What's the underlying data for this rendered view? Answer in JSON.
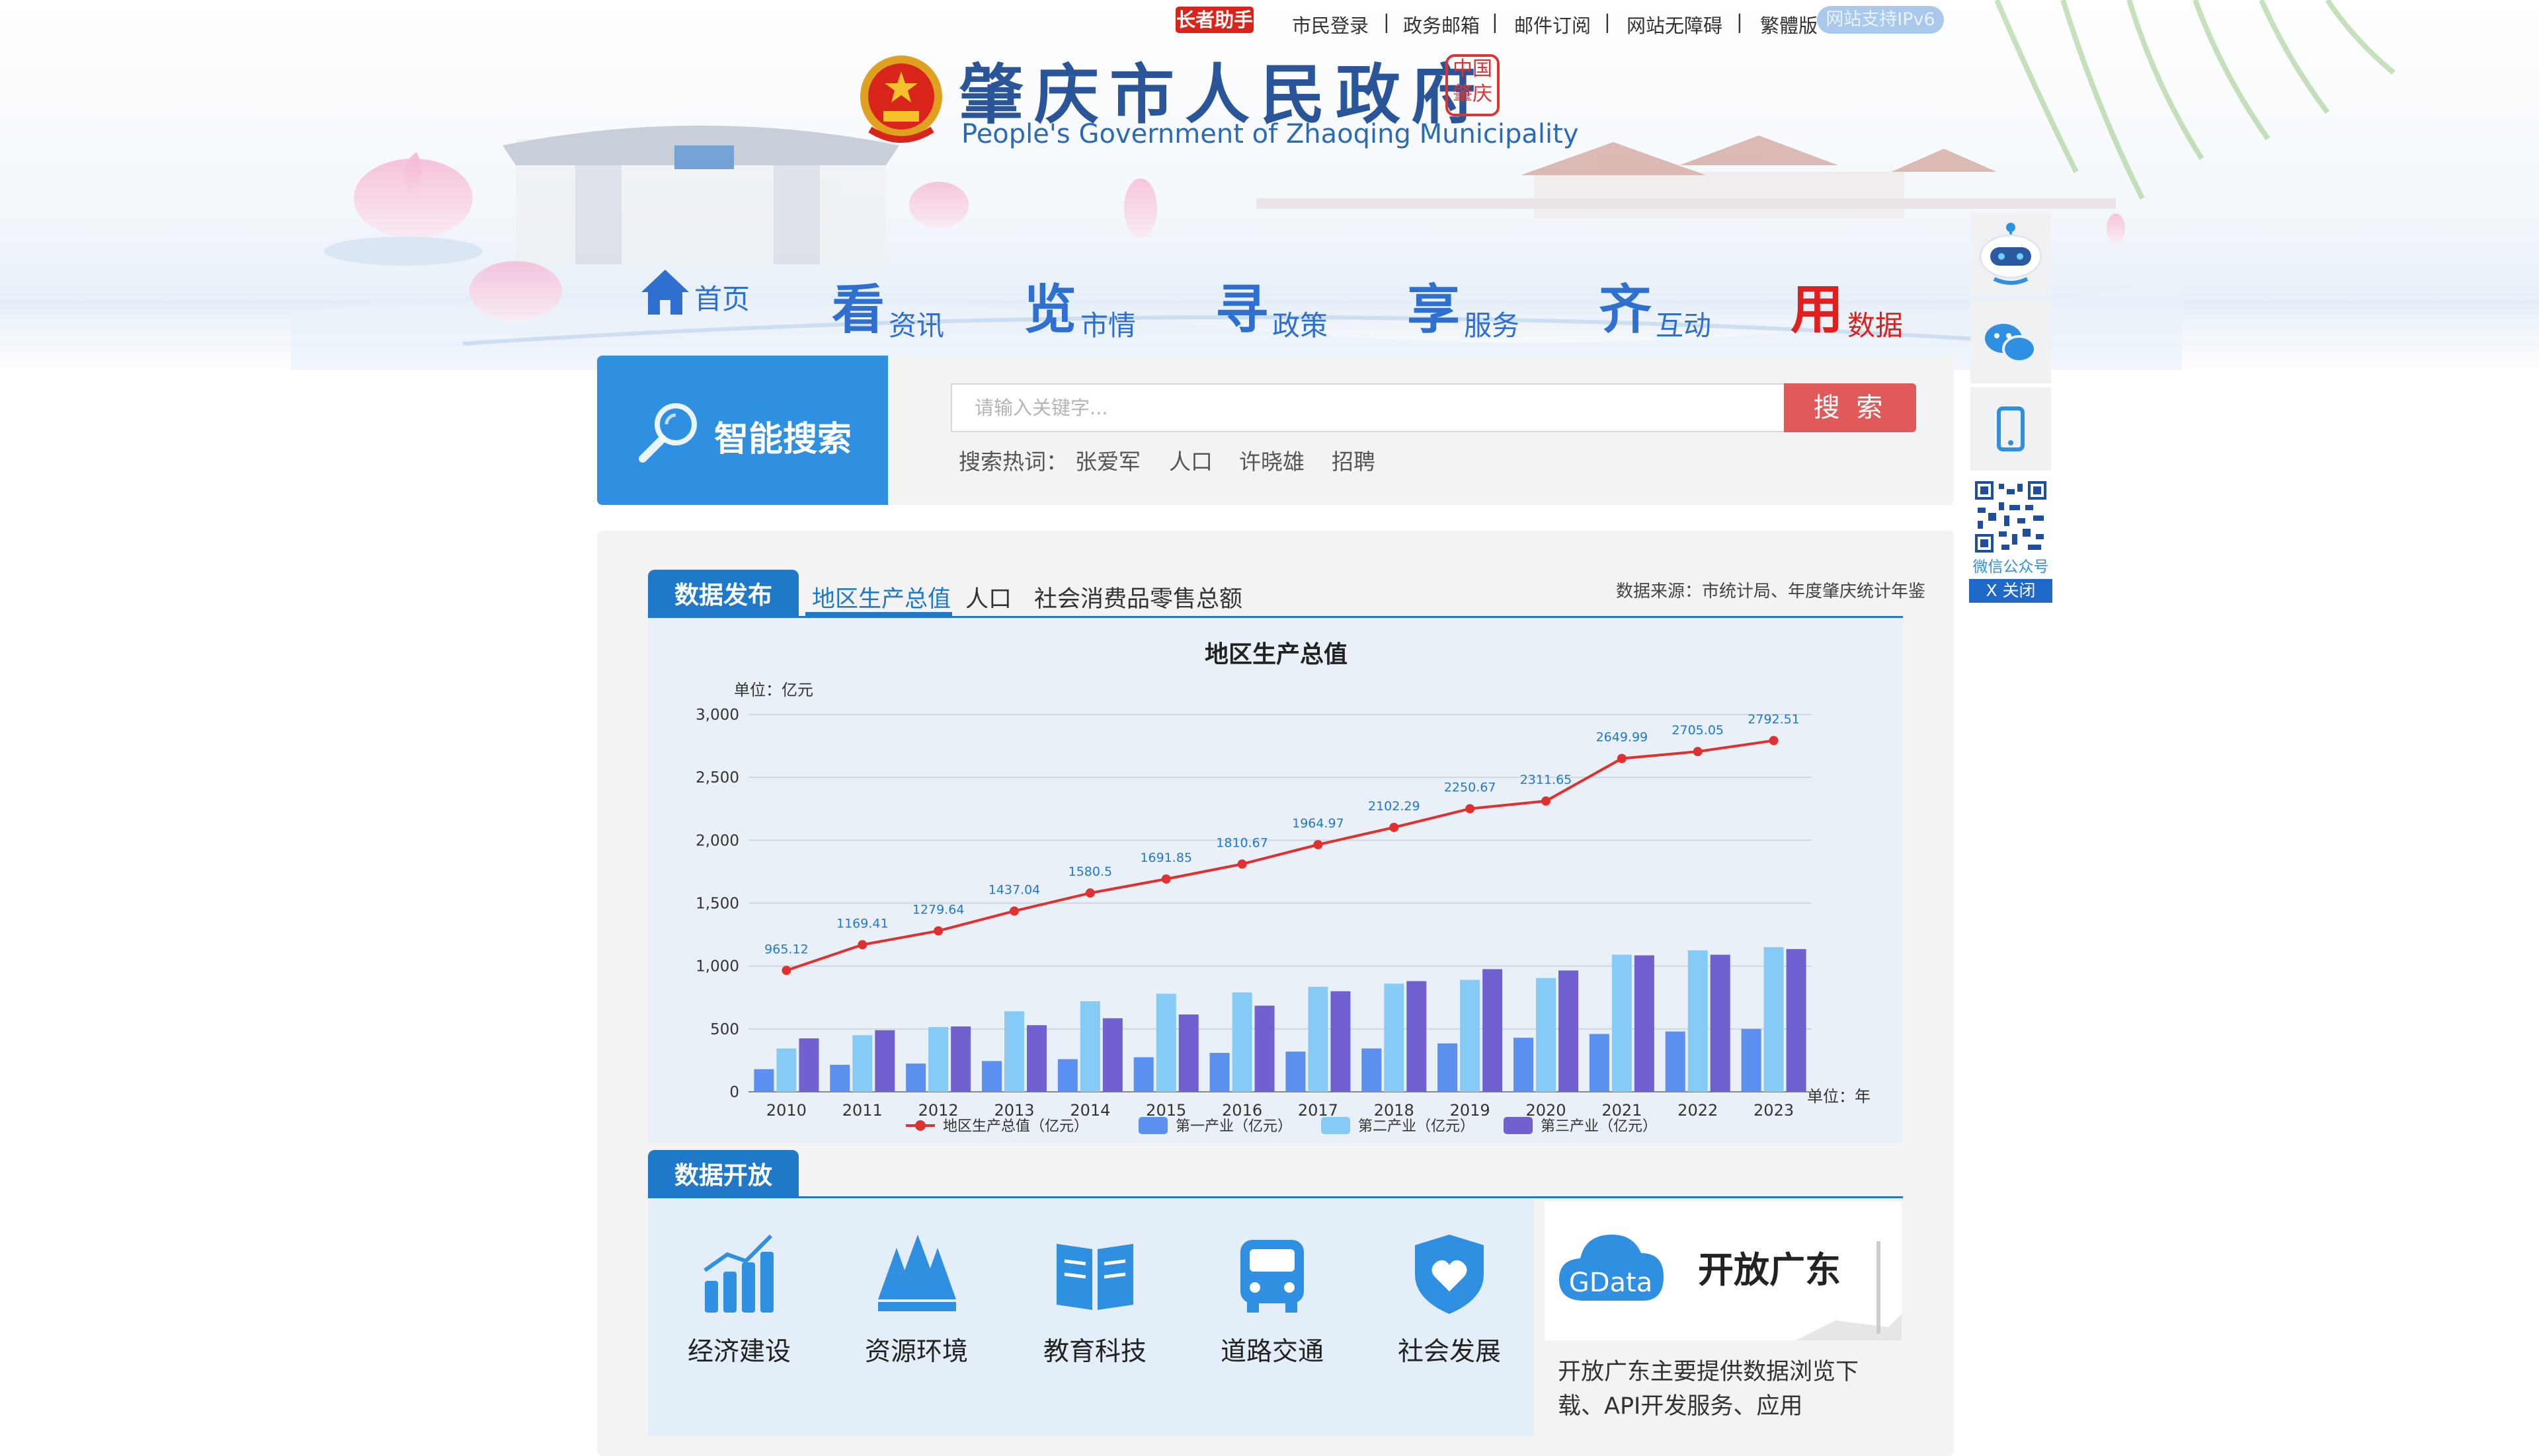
{
  "toolbar": {
    "elder_mode": "长者助手",
    "links": [
      "市民登录",
      "政务邮箱",
      "邮件订阅",
      "网站无障碍",
      "繁體版"
    ],
    "separator": "|",
    "ipv6": "网站支持IPv6"
  },
  "header": {
    "title_cn": "肇庆市人民政府",
    "title_en": "People's Government of Zhaoqing Municipality",
    "seal_text": "中国肇庆"
  },
  "nav": [
    {
      "big": "",
      "label": "首页",
      "icon": "home-icon"
    },
    {
      "big": "看",
      "label": "资讯"
    },
    {
      "big": "览",
      "label": "市情"
    },
    {
      "big": "寻",
      "label": "政策"
    },
    {
      "big": "享",
      "label": "服务"
    },
    {
      "big": "齐",
      "label": "互动"
    },
    {
      "big": "用",
      "label": "数据"
    }
  ],
  "search": {
    "block_label": "智能搜索",
    "placeholder": "请输入关键字...",
    "button": "搜 索",
    "hot_label": "搜索热词：",
    "hot_words": [
      "张爱军",
      "人口",
      "许晓雄",
      "招聘"
    ]
  },
  "data_panel": {
    "tab_publish": "数据发布",
    "tabs": [
      "地区生产总值",
      "人口",
      "社会消费品零售总额"
    ],
    "active_tab": "地区生产总值",
    "source": "数据来源：市统计局、年度肇庆统计年鉴"
  },
  "chart_data": {
    "type": "bar",
    "title": "地区生产总值",
    "ylabel": "单位：亿元",
    "xlabel": "单位：年",
    "ylim": [
      0,
      3000
    ],
    "yticks": [
      "0",
      "500",
      "1,000",
      "1,500",
      "2,000",
      "2,500",
      "3,000"
    ],
    "categories": [
      "2010",
      "2011",
      "2012",
      "2013",
      "2014",
      "2015",
      "2016",
      "2017",
      "2018",
      "2019",
      "2020",
      "2021",
      "2022",
      "2023"
    ],
    "series": [
      {
        "name": "地区生产总值（亿元）",
        "kind": "line",
        "color": "#e03131",
        "values": [
          965.12,
          1169.41,
          1279.64,
          1437.04,
          1580.5,
          1691.85,
          1810.67,
          1964.97,
          2102.29,
          2250.67,
          2311.65,
          2649.99,
          2705.05,
          2792.51
        ]
      },
      {
        "name": "第一产业（亿元）",
        "kind": "bar",
        "color": "#5b8ff0",
        "values": [
          180,
          215,
          225,
          245,
          260,
          275,
          310,
          320,
          345,
          385,
          430,
          460,
          480,
          500
        ]
      },
      {
        "name": "第二产业（亿元）",
        "kind": "bar",
        "color": "#86cbf6",
        "values": [
          345,
          450,
          515,
          640,
          720,
          780,
          790,
          835,
          860,
          890,
          905,
          1090,
          1125,
          1150
        ]
      },
      {
        "name": "第三产业（亿元）",
        "kind": "bar",
        "color": "#7161d0",
        "values": [
          425,
          490,
          520,
          530,
          585,
          615,
          685,
          800,
          880,
          975,
          965,
          1085,
          1090,
          1135
        ]
      }
    ],
    "legend_position": "bottom",
    "grid": true
  },
  "open_data": {
    "tab": "数据开放",
    "categories": [
      "经济建设",
      "资源环境",
      "教育科技",
      "道路交通",
      "社会发展"
    ],
    "gdata_logo": "GData",
    "gdata_title": "开放广东",
    "gdata_desc": "开放广东主要提供数据浏览下载、API开发服务、应用"
  },
  "sidebar": {
    "qr_label": "微信公众号",
    "close": "X 关闭"
  }
}
